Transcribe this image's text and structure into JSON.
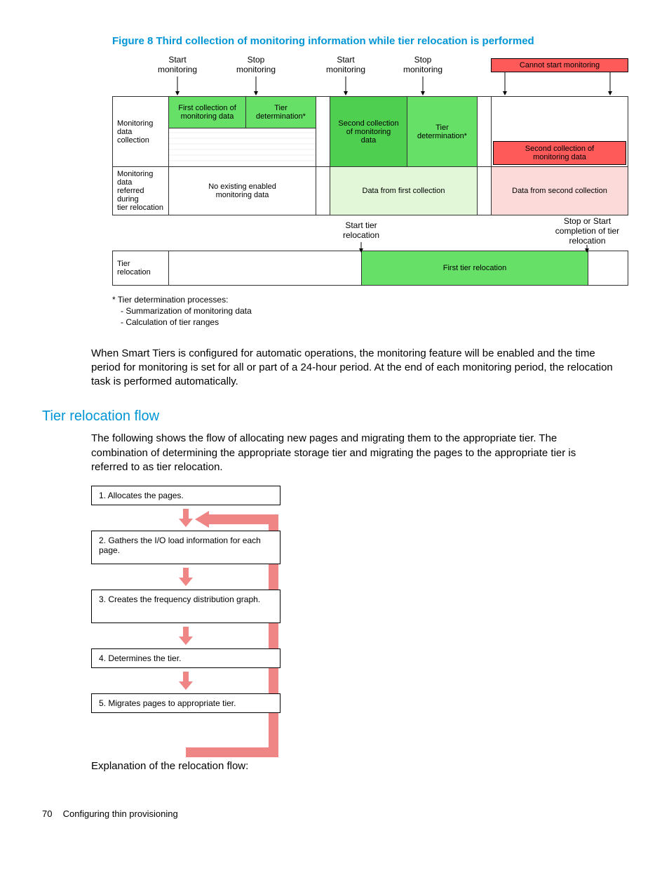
{
  "figure": {
    "title": "Figure 8 Third collection of monitoring information while tier relocation is performed",
    "top_labels": {
      "l1": "Start\nmonitoring",
      "l2": "Stop\nmonitoring",
      "l3": "Start\nmonitoring",
      "l4": "Stop\nmonitoring",
      "err": "Cannot start monitoring"
    },
    "row1_label": "Monitoring\ndata\ncollection",
    "row1_cells": {
      "c1": "First collection of\nmonitoring data",
      "c2": "Tier\ndetermination*",
      "c3": "Second collection\nof monitoring\ndata",
      "c4": "Tier\ndetermination*",
      "c5": "Second collection of\nmonitoring data"
    },
    "row2_label": "Monitoring data\nreferred during\ntier relocation",
    "row2_cells": {
      "c1": "No existing enabled\nmonitoring data",
      "c2": "Data from first collection",
      "c3": "Data from second collection"
    },
    "row3_labels": {
      "l1": "Start tier\nrelocation",
      "l2": "Stop or Start\ncompletion of tier\nrelocation"
    },
    "row3_rowlabel": "Tier\nrelocation",
    "row3_cell": "First tier relocation"
  },
  "footnote": {
    "l1": "* Tier determination processes:",
    "l2": "  - Summarization of monitoring data",
    "l3": "  - Calculation of tier ranges"
  },
  "para1": "When Smart Tiers is configured for automatic operations, the monitoring feature will be enabled and the time period for monitoring is set for all or part of a 24-hour period. At the end of each monitoring period, the relocation task is performed automatically.",
  "section_title": "Tier relocation flow",
  "para2": "The following shows the flow of allocating new pages and migrating them to the appropriate tier. The combination of determining the appropriate storage tier and migrating the pages to the appropriate tier is referred to as tier relocation.",
  "flow": {
    "s1": "1. Allocates the pages.",
    "s2": "2. Gathers the I/O load information for each page.",
    "s3": "3. Creates the frequency distribution graph.",
    "s4": "4. Determines the tier.",
    "s5": "5. Migrates pages to appropriate tier."
  },
  "para3": "Explanation of the relocation flow:",
  "footer": {
    "page": "70",
    "chapter": "Configuring thin provisioning"
  }
}
